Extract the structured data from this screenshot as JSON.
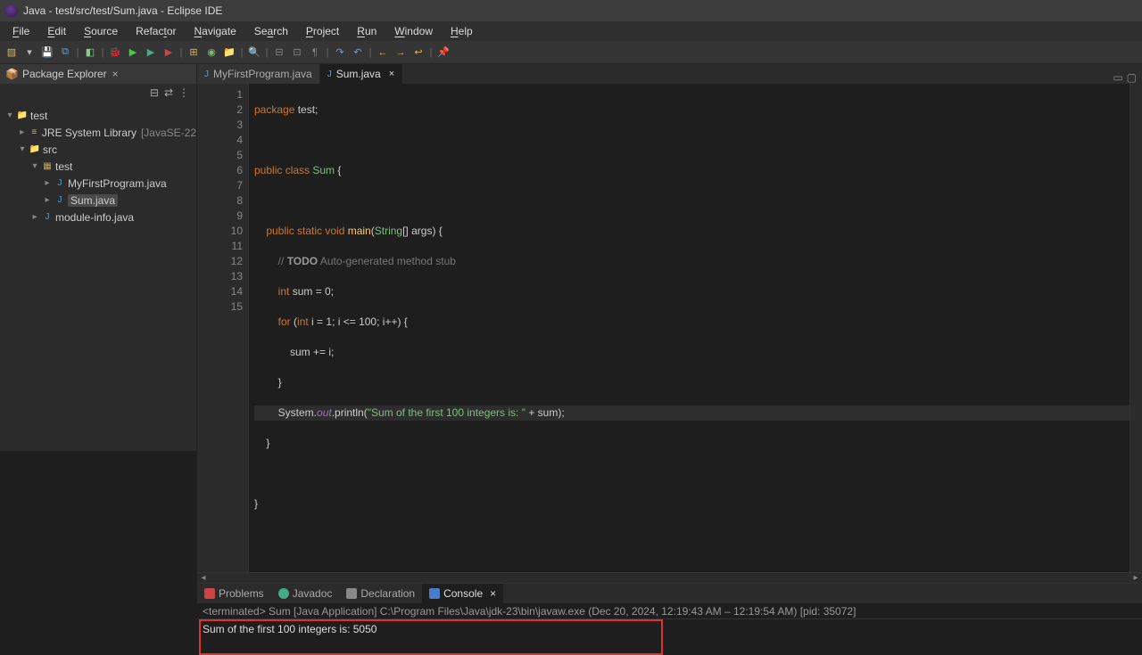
{
  "title": "Java - test/src/test/Sum.java - Eclipse IDE",
  "menus": [
    "File",
    "Edit",
    "Source",
    "Refactor",
    "Navigate",
    "Search",
    "Project",
    "Run",
    "Window",
    "Help"
  ],
  "package_explorer": {
    "title": "Package Explorer"
  },
  "tree": {
    "project": "test",
    "jre": "JRE System Library",
    "jre_suffix": "[JavaSE-22",
    "src": "src",
    "pkg": "test",
    "file1": "MyFirstProgram.java",
    "file2": "Sum.java",
    "file3": "module-info.java"
  },
  "tabs": {
    "t1": "MyFirstProgram.java",
    "t2": "Sum.java"
  },
  "code": {
    "l1a": "package",
    "l1b": " test;",
    "l3a": "public class ",
    "l3b": "Sum",
    "l3c": " {",
    "l5a": "    public static void ",
    "l5b": "main",
    "l5c": "(",
    "l5d": "String",
    "l5e": "[] args) {",
    "l6a": "        // ",
    "l6b": "TODO",
    "l6c": " Auto-generated method stub",
    "l7a": "        int",
    "l7b": " sum = 0;",
    "l8a": "        for",
    "l8b": " (",
    "l8c": "int",
    "l8d": " i = 1; i <= 100; i++) {",
    "l9": "            sum += i;",
    "l10": "        }",
    "l11a": "        System.",
    "l11b": "out",
    "l11c": ".println(",
    "l11d": "\"Sum of the first 100 integers is: \"",
    "l11e": " + sum);",
    "l12": "    }",
    "l14": "}"
  },
  "lines": [
    "1",
    "2",
    "3",
    "4",
    "5",
    "6",
    "7",
    "8",
    "9",
    "10",
    "11",
    "12",
    "13",
    "14",
    "15"
  ],
  "bottom_tabs": {
    "problems": "Problems",
    "javadoc": "Javadoc",
    "declaration": "Declaration",
    "console": "Console"
  },
  "console": {
    "status": "<terminated> Sum [Java Application] C:\\Program Files\\Java\\jdk-23\\bin\\javaw.exe  (Dec 20, 2024, 12:19:43 AM – 12:19:54 AM) [pid: 35072]",
    "output": "Sum of the first 100 integers is: 5050"
  }
}
